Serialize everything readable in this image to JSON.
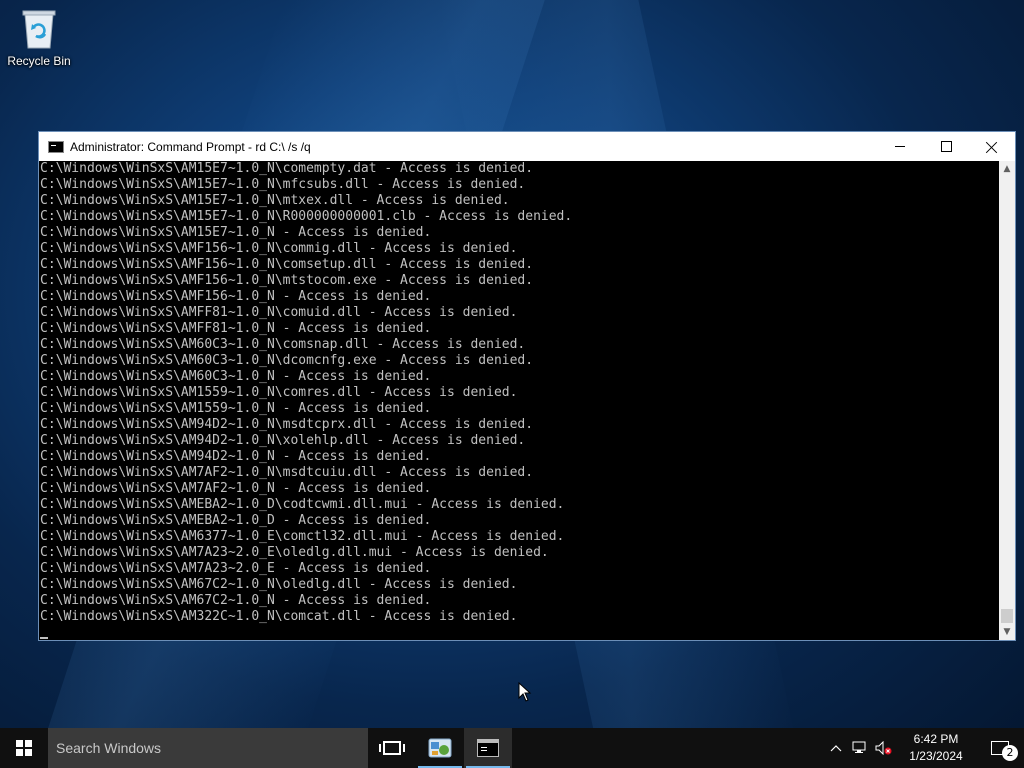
{
  "desktop": {
    "icons": [
      {
        "label": "Recycle Bin",
        "icon": "recycle-bin-icon"
      }
    ]
  },
  "window": {
    "title": "Administrator: Command Prompt - rd  C:\\ /s /q",
    "controls": {
      "minimize": "minimize-icon",
      "maximize": "maximize-icon",
      "close": "close-icon"
    },
    "console_lines": [
      "C:\\Windows\\WinSxS\\AM15E7~1.0_N\\comempty.dat - Access is denied.",
      "C:\\Windows\\WinSxS\\AM15E7~1.0_N\\mfcsubs.dll - Access is denied.",
      "C:\\Windows\\WinSxS\\AM15E7~1.0_N\\mtxex.dll - Access is denied.",
      "C:\\Windows\\WinSxS\\AM15E7~1.0_N\\R000000000001.clb - Access is denied.",
      "C:\\Windows\\WinSxS\\AM15E7~1.0_N - Access is denied.",
      "C:\\Windows\\WinSxS\\AMF156~1.0_N\\commig.dll - Access is denied.",
      "C:\\Windows\\WinSxS\\AMF156~1.0_N\\comsetup.dll - Access is denied.",
      "C:\\Windows\\WinSxS\\AMF156~1.0_N\\mtstocom.exe - Access is denied.",
      "C:\\Windows\\WinSxS\\AMF156~1.0_N - Access is denied.",
      "C:\\Windows\\WinSxS\\AMFF81~1.0_N\\comuid.dll - Access is denied.",
      "C:\\Windows\\WinSxS\\AMFF81~1.0_N - Access is denied.",
      "C:\\Windows\\WinSxS\\AM60C3~1.0_N\\comsnap.dll - Access is denied.",
      "C:\\Windows\\WinSxS\\AM60C3~1.0_N\\dcomcnfg.exe - Access is denied.",
      "C:\\Windows\\WinSxS\\AM60C3~1.0_N - Access is denied.",
      "C:\\Windows\\WinSxS\\AM1559~1.0_N\\comres.dll - Access is denied.",
      "C:\\Windows\\WinSxS\\AM1559~1.0_N - Access is denied.",
      "C:\\Windows\\WinSxS\\AM94D2~1.0_N\\msdtcprx.dll - Access is denied.",
      "C:\\Windows\\WinSxS\\AM94D2~1.0_N\\xolehlp.dll - Access is denied.",
      "C:\\Windows\\WinSxS\\AM94D2~1.0_N - Access is denied.",
      "C:\\Windows\\WinSxS\\AM7AF2~1.0_N\\msdtcuiu.dll - Access is denied.",
      "C:\\Windows\\WinSxS\\AM7AF2~1.0_N - Access is denied.",
      "C:\\Windows\\WinSxS\\AMEBA2~1.0_D\\codtcwmi.dll.mui - Access is denied.",
      "C:\\Windows\\WinSxS\\AMEBA2~1.0_D - Access is denied.",
      "C:\\Windows\\WinSxS\\AM6377~1.0_E\\comctl32.dll.mui - Access is denied.",
      "C:\\Windows\\WinSxS\\AM7A23~2.0_E\\oledlg.dll.mui - Access is denied.",
      "C:\\Windows\\WinSxS\\AM7A23~2.0_E - Access is denied.",
      "C:\\Windows\\WinSxS\\AM67C2~1.0_N\\oledlg.dll - Access is denied.",
      "C:\\Windows\\WinSxS\\AM67C2~1.0_N - Access is denied.",
      "C:\\Windows\\WinSxS\\AM322C~1.0_N\\comcat.dll - Access is denied."
    ]
  },
  "taskbar": {
    "search_placeholder": "Search Windows",
    "clock": {
      "time": "6:42 PM",
      "date": "1/23/2024"
    },
    "notification_count": "2",
    "tray_icons": [
      "chevron-up-icon",
      "network-icon",
      "volume-muted-icon"
    ]
  }
}
